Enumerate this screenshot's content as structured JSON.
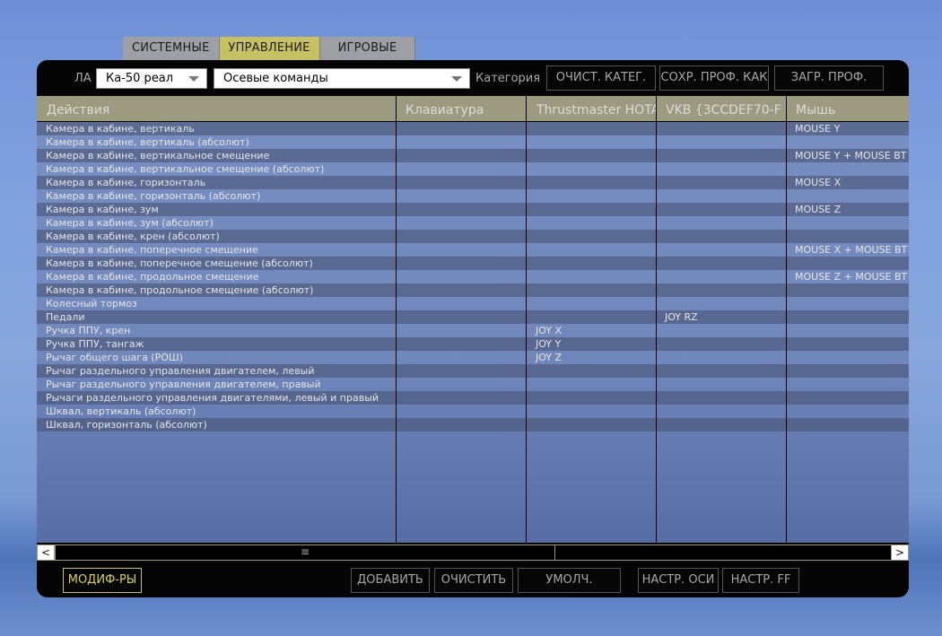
{
  "top_tabs": [
    {
      "label": "СИСТЕМНЫЕ",
      "active": false
    },
    {
      "label": "УПРАВЛЕНИЕ",
      "active": true
    },
    {
      "label": "ИГРОВЫЕ",
      "active": false
    }
  ],
  "toolbar": {
    "aircraft_label": "ЛА",
    "aircraft_value": "Ка-50 реал",
    "category_value": "Осевые команды",
    "category_label": "Категория",
    "clear_category": "ОЧИСТ. КАТЕГ.",
    "save_profile_as": "СОХР. ПРОФ. КАК",
    "load_profile": "ЗАГР. ПРОФ."
  },
  "columns": [
    "Действия",
    "Клавиатура",
    "Thrustmaster HOTAS",
    "VKB  {3CCDEF70-F",
    "Мышь"
  ],
  "rows": [
    {
      "action": "Камера в кабине, вертикаль",
      "keyboard": "",
      "thrustmaster": "",
      "vkb": "",
      "mouse": "MOUSE Y"
    },
    {
      "action": "Камера в кабине, вертикаль (абсолют)",
      "keyboard": "",
      "thrustmaster": "",
      "vkb": "",
      "mouse": ""
    },
    {
      "action": "Камера в кабине, вертикальное смещение",
      "keyboard": "",
      "thrustmaster": "",
      "vkb": "",
      "mouse": "MOUSE Y + MOUSE BT"
    },
    {
      "action": "Камера в кабине, вертикальное смещение (абсолют)",
      "keyboard": "",
      "thrustmaster": "",
      "vkb": "",
      "mouse": ""
    },
    {
      "action": "Камера в кабине, горизонталь",
      "keyboard": "",
      "thrustmaster": "",
      "vkb": "",
      "mouse": "MOUSE X"
    },
    {
      "action": "Камера в кабине, горизонталь (абсолют)",
      "keyboard": "",
      "thrustmaster": "",
      "vkb": "",
      "mouse": ""
    },
    {
      "action": "Камера в кабине, зум",
      "keyboard": "",
      "thrustmaster": "",
      "vkb": "",
      "mouse": "MOUSE Z"
    },
    {
      "action": "Камера в кабине, зум (абсолют)",
      "keyboard": "",
      "thrustmaster": "",
      "vkb": "",
      "mouse": ""
    },
    {
      "action": "Камера в кабине, крен (абсолют)",
      "keyboard": "",
      "thrustmaster": "",
      "vkb": "",
      "mouse": ""
    },
    {
      "action": "Камера в кабине, поперечное смещение",
      "keyboard": "",
      "thrustmaster": "",
      "vkb": "",
      "mouse": "MOUSE X + MOUSE BT"
    },
    {
      "action": "Камера в кабине, поперечное смещение (абсолют)",
      "keyboard": "",
      "thrustmaster": "",
      "vkb": "",
      "mouse": ""
    },
    {
      "action": "Камера в кабине, продольное смещение",
      "keyboard": "",
      "thrustmaster": "",
      "vkb": "",
      "mouse": "MOUSE Z + MOUSE BT"
    },
    {
      "action": "Камера в кабине, продольное смещение (абсолют)",
      "keyboard": "",
      "thrustmaster": "",
      "vkb": "",
      "mouse": ""
    },
    {
      "action": "Колесный тормоз",
      "keyboard": "",
      "thrustmaster": "",
      "vkb": "",
      "mouse": ""
    },
    {
      "action": "Педали",
      "keyboard": "",
      "thrustmaster": "",
      "vkb": "JOY RZ",
      "mouse": ""
    },
    {
      "action": "Ручка ППУ, крен",
      "keyboard": "",
      "thrustmaster": "JOY X",
      "vkb": "",
      "mouse": ""
    },
    {
      "action": "Ручка ППУ, тангаж",
      "keyboard": "",
      "thrustmaster": "JOY Y",
      "vkb": "",
      "mouse": ""
    },
    {
      "action": "Рычаг общего шага (РОШ)",
      "keyboard": "",
      "thrustmaster": "JOY Z",
      "vkb": "",
      "mouse": ""
    },
    {
      "action": "Рычаг раздельного управления двигателем, левый",
      "keyboard": "",
      "thrustmaster": "",
      "vkb": "",
      "mouse": ""
    },
    {
      "action": "Рычаг раздельного управления двигателем, правый",
      "keyboard": "",
      "thrustmaster": "",
      "vkb": "",
      "mouse": ""
    },
    {
      "action": "Рычаги раздельного управления двигателями, левый и правый",
      "keyboard": "",
      "thrustmaster": "",
      "vkb": "",
      "mouse": ""
    },
    {
      "action": "Шквал, вертикаль (абсолют)",
      "keyboard": "",
      "thrustmaster": "",
      "vkb": "",
      "mouse": ""
    },
    {
      "action": "Шквал, горизонталь (абсолют)",
      "keyboard": "",
      "thrustmaster": "",
      "vkb": "",
      "mouse": ""
    }
  ],
  "scrollbar": {
    "left_arrow": "<",
    "right_arrow": ">",
    "thumb_grip": "≡"
  },
  "bottom": {
    "modifiers": "МОДИФ-РЫ",
    "add": "ДОБАВИТЬ",
    "clear": "ОЧИСТИТЬ",
    "default": "УМОЛЧ.",
    "axis_tune": "НАСТР. ОСИ",
    "ff_tune": "НАСТР. FF"
  },
  "colors": {
    "accent": "#c8c164",
    "header": "#9c9a7f",
    "window": "#050505"
  }
}
